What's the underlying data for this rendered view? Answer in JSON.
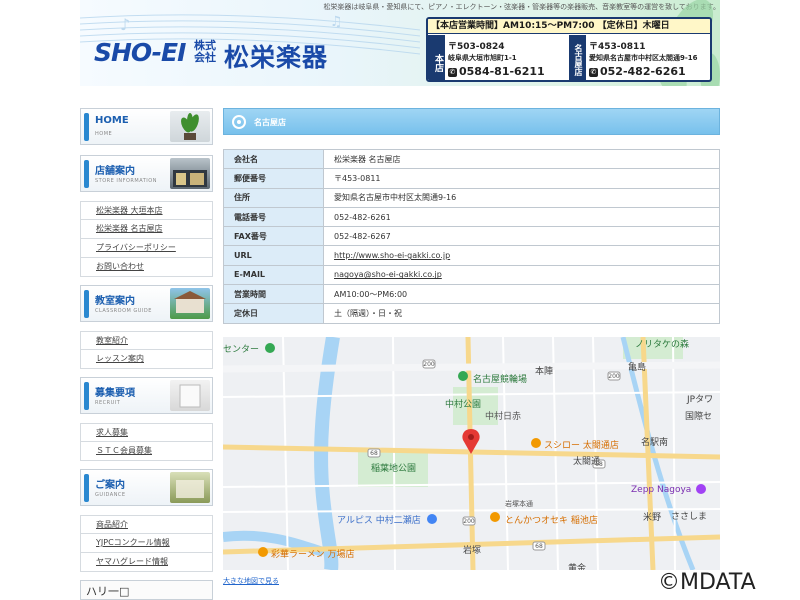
{
  "header": {
    "tagline": "松栄楽器は岐阜県・愛知県にて、ピアノ・エレクトーン・弦楽器・管楽器等の楽器販売、音楽教室等の運営を致しております。",
    "logo_roman": "SHO-EI",
    "logo_kabushiki": "株式会社",
    "logo_name": "松栄楽器",
    "hours": "【本店営業時間】AM10:15～PM7:00 【定休日】木曜日",
    "stores": [
      {
        "tag": "本店",
        "zip": "〒503-0824",
        "address": "岐阜県大垣市旭町1-1",
        "tel": "0584-81-6211"
      },
      {
        "tag": "名古屋店",
        "zip": "〒453-0811",
        "address": "愛知県名古屋市中村区太閤通9-16",
        "tel": "052-482-6261"
      }
    ]
  },
  "sidebar": {
    "home": {
      "title": "HOME",
      "sub": "HOME"
    },
    "shop": {
      "title": "店舗案内",
      "sub": "STORE INFORMATION"
    },
    "shop_links": [
      "松栄楽器 大垣本店",
      "松栄楽器 名古屋店",
      "プライバシーポリシー",
      "お問い合わせ"
    ],
    "school": {
      "title": "教室案内",
      "sub": "CLASSROOM GUIDE"
    },
    "school_links": [
      "教室紹介",
      "レッスン案内"
    ],
    "recruit": {
      "title": "募集要項",
      "sub": "RECRUIT"
    },
    "recruit_links": [
      "求人募集",
      "ＳＴＣ会員募集"
    ],
    "guide": {
      "title": "ご案内",
      "sub": "GUIDANCE"
    },
    "guide_links": [
      "商品紹介",
      "YJPCコンクール情報",
      "ヤマハグレード情報"
    ],
    "bottom_label": "ハリ一□"
  },
  "main": {
    "section_title": "名古屋店",
    "rows": [
      {
        "label": "会社名",
        "value": "松栄楽器 名古屋店",
        "link": false
      },
      {
        "label": "郵便番号",
        "value": "〒453-0811",
        "link": false
      },
      {
        "label": "住所",
        "value": "愛知県名古屋市中村区太閤通9-16",
        "link": false
      },
      {
        "label": "電話番号",
        "value": "052-482-6261",
        "link": false
      },
      {
        "label": "FAX番号",
        "value": "052-482-6267",
        "link": false
      },
      {
        "label": "URL",
        "value": "http://www.sho-ei-gakki.co.jp",
        "link": true
      },
      {
        "label": "E-MAIL",
        "value": "nagoya@sho-ei-gakki.co.jp",
        "link": true
      },
      {
        "label": "営業時間",
        "value": "AM10:00～PM6:00",
        "link": false
      },
      {
        "label": "定休日",
        "value": "土（隔週）・日・祝",
        "link": false
      }
    ]
  },
  "map": {
    "labels": {
      "center": "センター",
      "keirin": "名古屋競輪場",
      "nakamura_park": "中村公園",
      "nakamura_hiyoshi": "中村日赤",
      "inaba": "稲葉地公園",
      "sushiro": "スシロー 太閤通店",
      "taiko": "太閤通",
      "arupisu": "アルピス 中村二瀬店",
      "tonkatsu": "とんかつオセキ 稲池店",
      "ramen": "彩華ラーメン 万場店",
      "iwatsuka": "岩塚",
      "honjin": "本陣",
      "kamejima": "亀島",
      "meieki": "名駅南",
      "zepp": "Zepp Nagoya",
      "yoneno": "米野",
      "jp": "JPタワ",
      "kokusai": "国際セ",
      "noritake": "ノリタケの森",
      "sasashima": "ささしま",
      "komeno_road": "岩塚本通",
      "kogane": "黄金"
    },
    "road_numbers": [
      "68",
      "200",
      "68",
      "200",
      "68",
      "200"
    ],
    "big_map_link": "大きな地図で見る"
  },
  "copyright": "©MDATA",
  "colors": {
    "accent_blue": "#1a4aa8",
    "section_head": "#78c1ec",
    "table_label_bg": "#dcecf8",
    "map_pin": "#e53935"
  }
}
